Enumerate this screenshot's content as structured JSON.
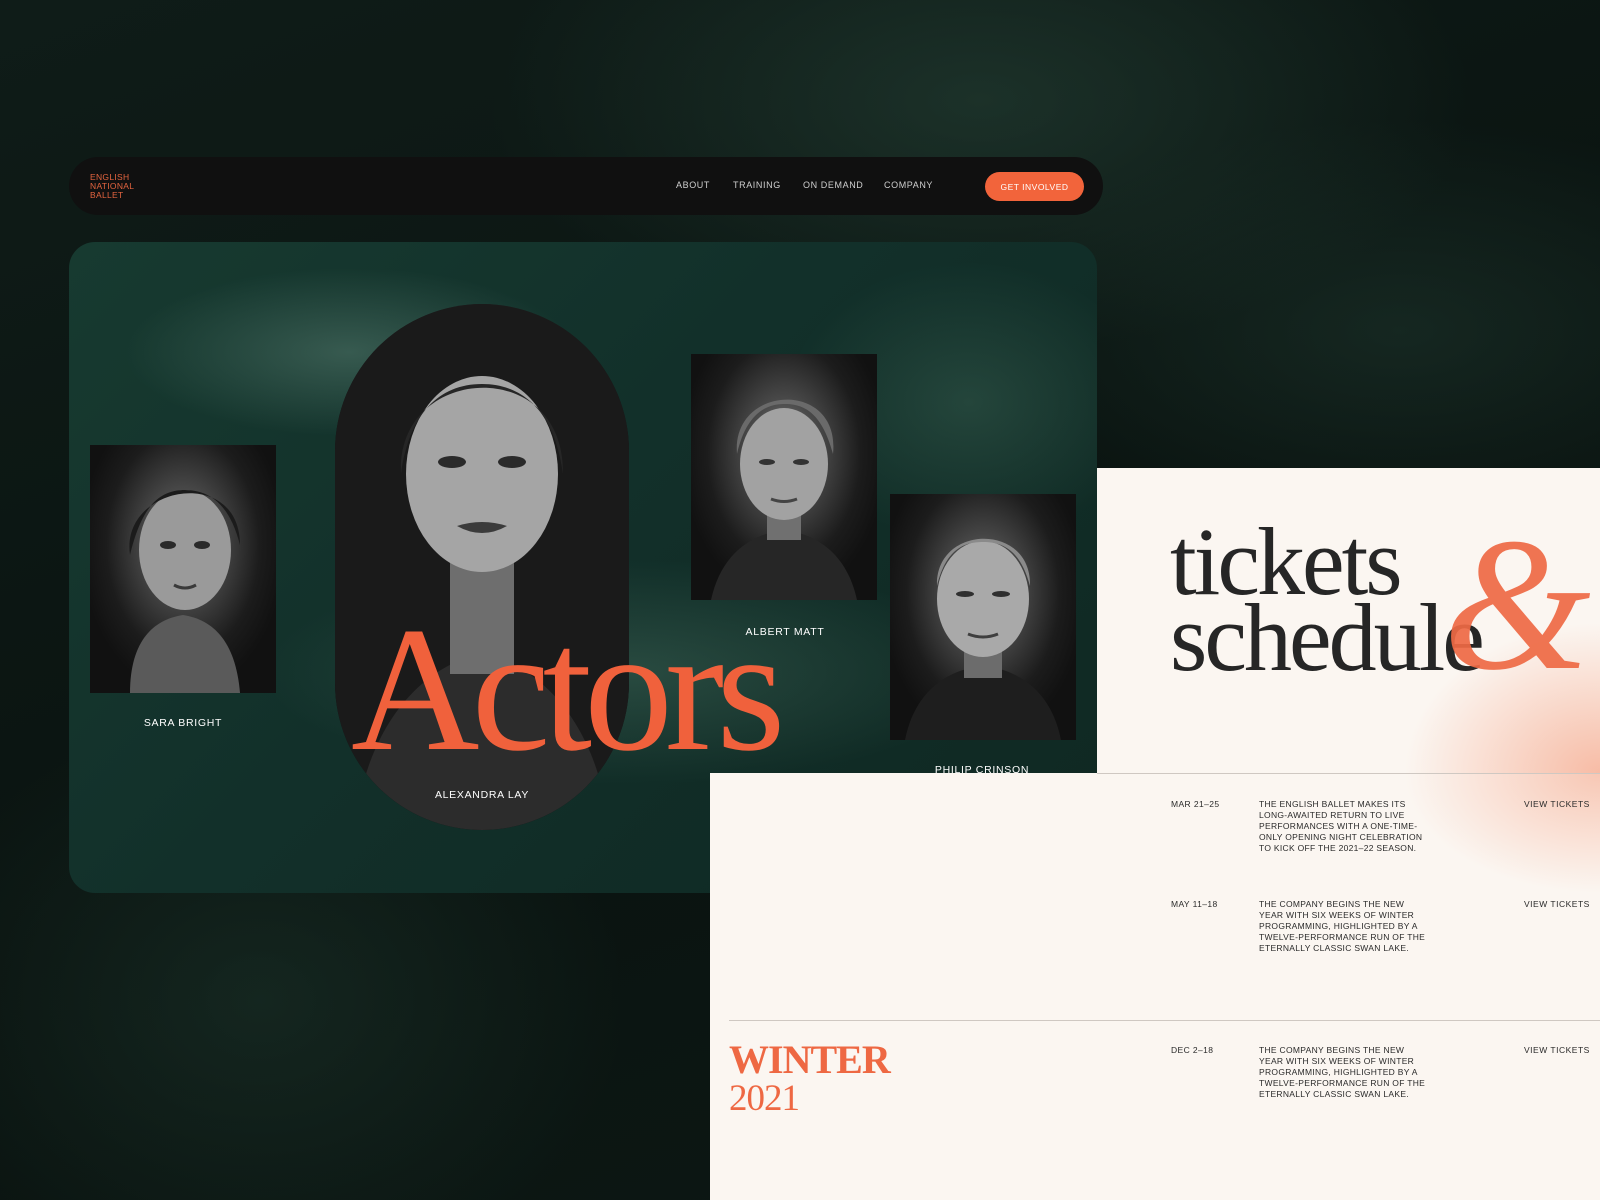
{
  "nav": {
    "logo_lines": [
      "ENGLISH",
      "NATIONAL",
      "BALLET"
    ],
    "links": [
      "ABOUT",
      "TRAINING",
      "ON DEMAND",
      "COMPANY"
    ],
    "cta": "GET INVOLVED"
  },
  "actors": {
    "title": "Actors",
    "people": [
      {
        "name": "SARA BRIGHT"
      },
      {
        "name": "ALEXANDRA LAY"
      },
      {
        "name": "ALBERT MATT"
      },
      {
        "name": "PHILIP CRINSON"
      }
    ]
  },
  "tickets": {
    "title_line1": "tickets",
    "title_line2": "schedule",
    "ampersand": "&",
    "season": {
      "line1": "WINTER",
      "line2": "2021"
    },
    "rows": [
      {
        "date": "MAR 21–25",
        "description": "THE ENGLISH BALLET MAKES ITS LONG-AWAITED RETURN TO LIVE PERFORMANCES WITH A ONE-TIME-ONLY OPENING NIGHT CELEBRATION TO KICK OFF THE 2021–22 SEASON.",
        "link": "VIEW TICKETS"
      },
      {
        "date": "MAY 11–18",
        "description": "THE COMPANY BEGINS THE NEW YEAR WITH SIX WEEKS OF WINTER PROGRAMMING, HIGHLIGHTED BY A TWELVE-PERFORMANCE RUN OF THE ETERNALLY CLASSIC SWAN LAKE.",
        "link": "VIEW TICKETS"
      },
      {
        "date": "DEC 2–18",
        "description": "THE COMPANY BEGINS THE NEW YEAR WITH SIX WEEKS OF WINTER PROGRAMMING, HIGHLIGHTED BY A TWELVE-PERFORMANCE RUN OF THE ETERNALLY CLASSIC SWAN LAKE.",
        "link": "VIEW TICKETS"
      }
    ]
  },
  "colors": {
    "accent": "#f2643b",
    "card_green": "#173a30",
    "cream": "#fbf6f1",
    "background": "#0c1512"
  }
}
